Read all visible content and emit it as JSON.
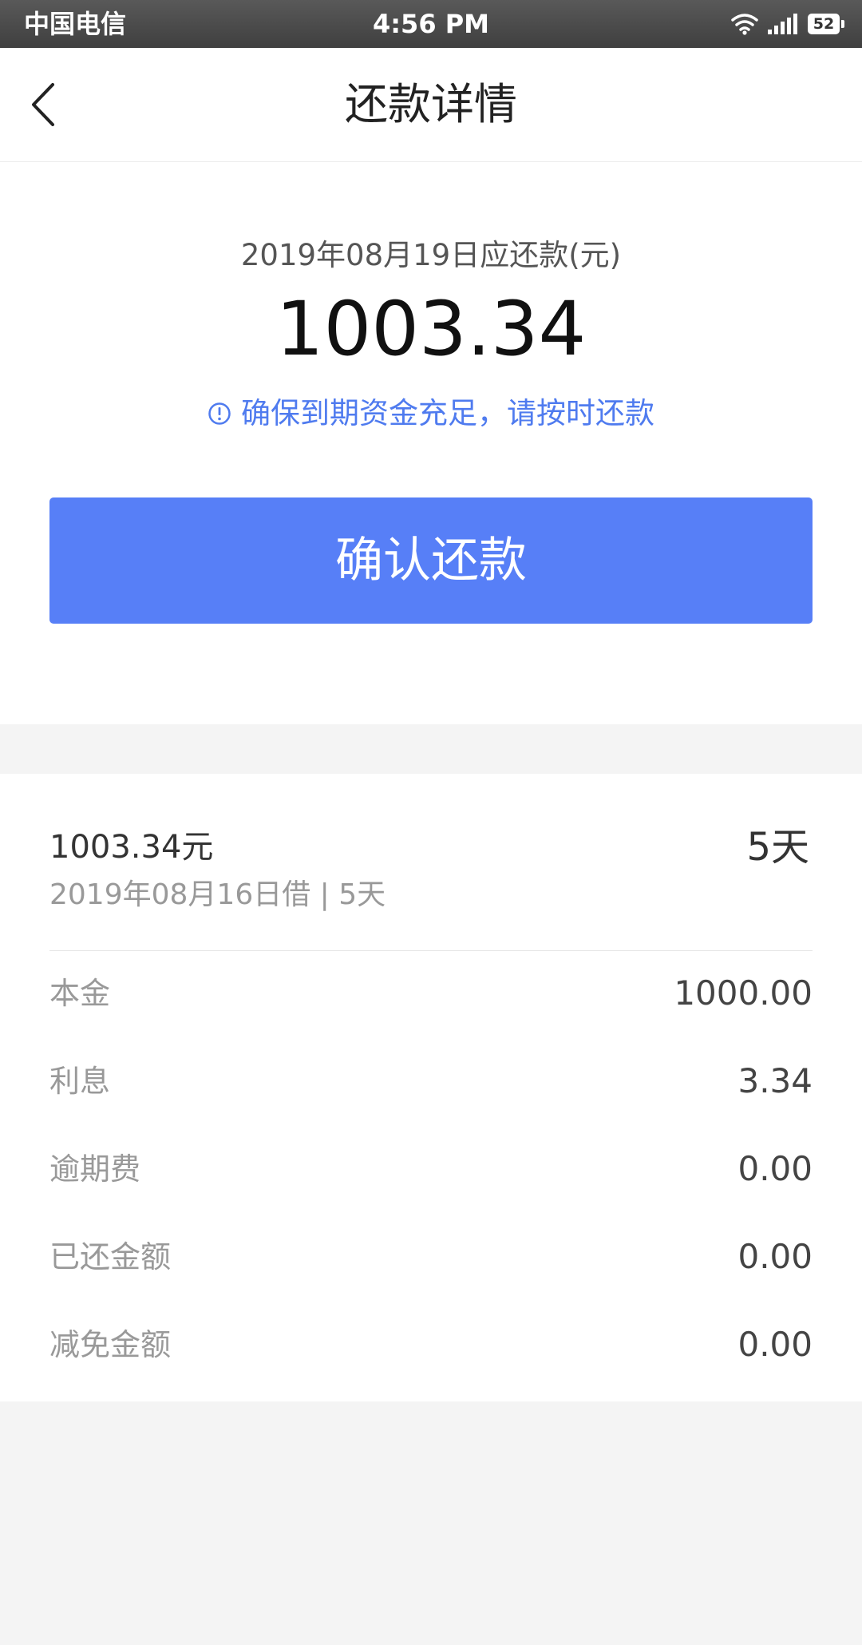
{
  "status_bar": {
    "carrier": "中国电信",
    "time": "4:56 PM",
    "battery": "52"
  },
  "nav": {
    "title": "还款详情"
  },
  "summary": {
    "due_caption": "2019年08月19日应还款(元)",
    "due_amount": "1003.34",
    "notice": "确保到期资金充足，请按时还款",
    "confirm_label": "确认还款"
  },
  "loan": {
    "amount": "1003.34元",
    "sub": "2019年08月16日借 | 5天",
    "term": "5天"
  },
  "details": [
    {
      "label": "本金",
      "value": "1000.00"
    },
    {
      "label": "利息",
      "value": "3.34"
    },
    {
      "label": "逾期费",
      "value": "0.00"
    },
    {
      "label": "已还金额",
      "value": "0.00"
    },
    {
      "label": "减免金额",
      "value": "0.00"
    }
  ],
  "colors": {
    "accent": "#577ff7",
    "notice": "#4f7bef",
    "background": "#f4f4f4"
  }
}
